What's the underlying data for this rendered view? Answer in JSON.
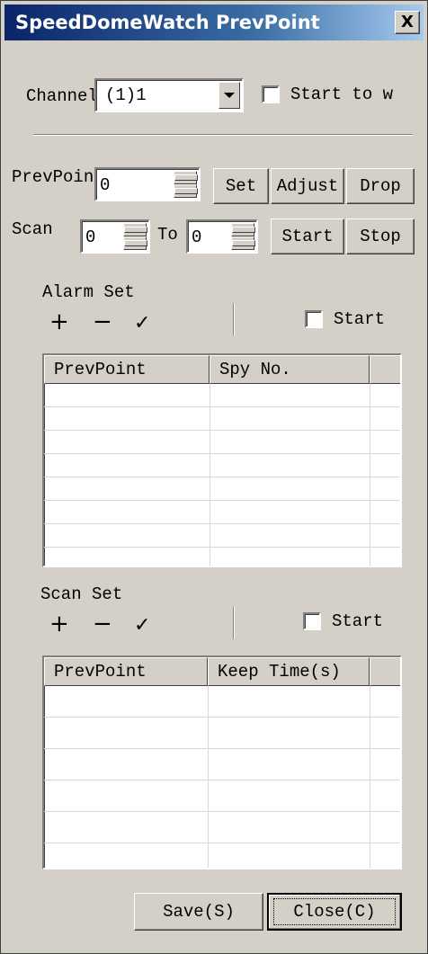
{
  "window": {
    "title": "SpeedDomeWatch PrevPoint",
    "close_glyph": "X"
  },
  "channel": {
    "label": "Channel",
    "value": "(1)1",
    "start_checkbox_label": "Start to w"
  },
  "prevpoint": {
    "label": "PrevPoint",
    "value": "0",
    "buttons": {
      "set": "Set",
      "adjust": "Adjust",
      "drop": "Drop"
    }
  },
  "scan": {
    "label": "Scan",
    "from_value": "0",
    "to_label": "To",
    "to_value": "0",
    "buttons": {
      "start": "Start",
      "stop": "Stop"
    }
  },
  "alarm_set": {
    "title": "Alarm Set",
    "toolbar": {
      "add": "+",
      "remove": "−",
      "confirm": "✓"
    },
    "start_label": "Start",
    "columns": [
      "PrevPoint",
      "Spy No.",
      ""
    ],
    "rows": [
      [],
      [],
      [],
      [],
      [],
      [],
      [],
      []
    ]
  },
  "scan_set": {
    "title": "Scan Set",
    "toolbar": {
      "add": "+",
      "remove": "−",
      "confirm": "✓"
    },
    "start_label": "Start",
    "columns": [
      "PrevPoint",
      "Keep Time(s)",
      ""
    ],
    "rows": [
      [],
      [],
      [],
      [],
      [],
      []
    ]
  },
  "footer": {
    "save": "Save(S)",
    "close": "Close(C)"
  },
  "colors": {
    "face": "#d4d0c8",
    "title_start": "#0a246a",
    "title_end": "#a6caf0"
  },
  "icons": [
    "close-icon",
    "dropdown-arrow-icon",
    "spin-up-icon",
    "spin-down-icon",
    "plus-icon",
    "minus-icon",
    "check-icon"
  ]
}
